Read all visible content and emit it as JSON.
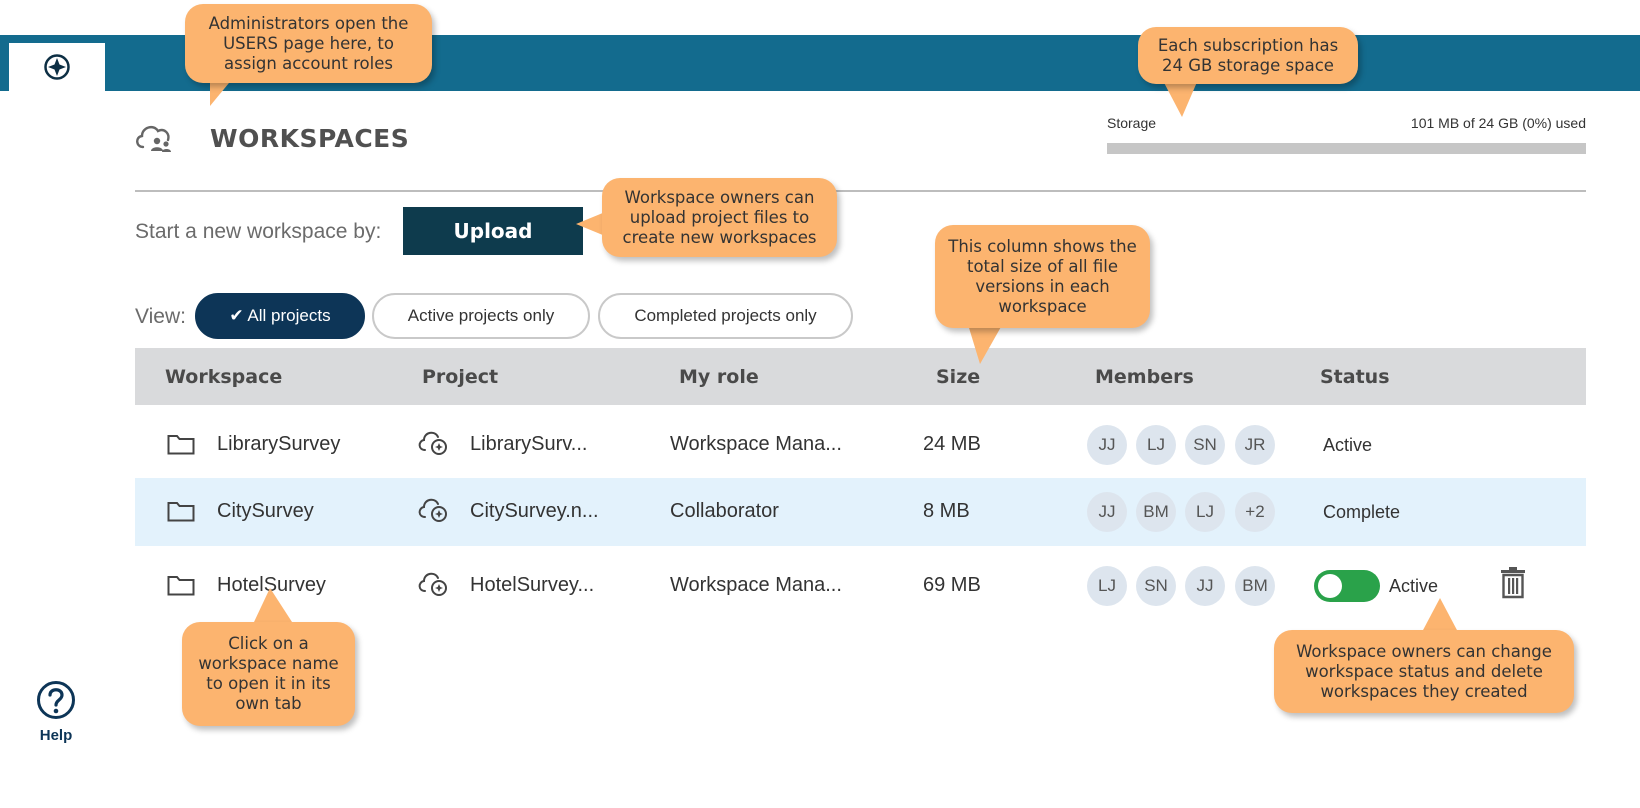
{
  "page": {
    "title": "WORKSPACES"
  },
  "storage": {
    "label": "Storage",
    "value": "101 MB of 24 GB (0%) used",
    "fraction": 0.0
  },
  "start": {
    "label": "Start a new workspace by:",
    "upload_label": "Upload"
  },
  "view": {
    "label": "View:",
    "filters": [
      {
        "label": "✔ All projects",
        "active": true
      },
      {
        "label": "Active projects only",
        "active": false
      },
      {
        "label": "Completed projects only",
        "active": false
      }
    ]
  },
  "table": {
    "headers": [
      "Workspace",
      "Project",
      "My role",
      "Size",
      "Members",
      "Status"
    ],
    "rows": [
      {
        "workspace": "LibrarySurvey",
        "project": "LibrarySurv...",
        "role": "Workspace Mana...",
        "size": "24 MB",
        "members": [
          "JJ",
          "LJ",
          "SN",
          "JR"
        ],
        "status": "Active"
      },
      {
        "workspace": "CitySurvey",
        "project": "CitySurvey.n...",
        "role": "Collaborator",
        "size": "8 MB",
        "members": [
          "JJ",
          "BM",
          "LJ",
          "+2"
        ],
        "status": "Complete"
      },
      {
        "workspace": "HotelSurvey",
        "project": "HotelSurvey...",
        "role": "Workspace Mana...",
        "size": "69 MB",
        "members": [
          "LJ",
          "SN",
          "JJ",
          "BM"
        ],
        "status": "Active"
      }
    ]
  },
  "help": {
    "label": "Help"
  },
  "callouts": {
    "admin": "Administrators open the USERS page here, to assign account roles",
    "storage": "Each subscription has 24 GB storage space",
    "upload": "Workspace owners can upload project files to create new workspaces",
    "size": "This column shows the total size of all file versions in each workspace",
    "name": "Click on a workspace name to open it in its own tab",
    "status": "Workspace owners can change workspace status and delete workspaces they created"
  },
  "colors": {
    "topbar": "#136b8e",
    "navy": "#0d3557",
    "toggle": "#2aa24a",
    "callout": "#fcb46f",
    "highlight": "#e3f2fc"
  }
}
